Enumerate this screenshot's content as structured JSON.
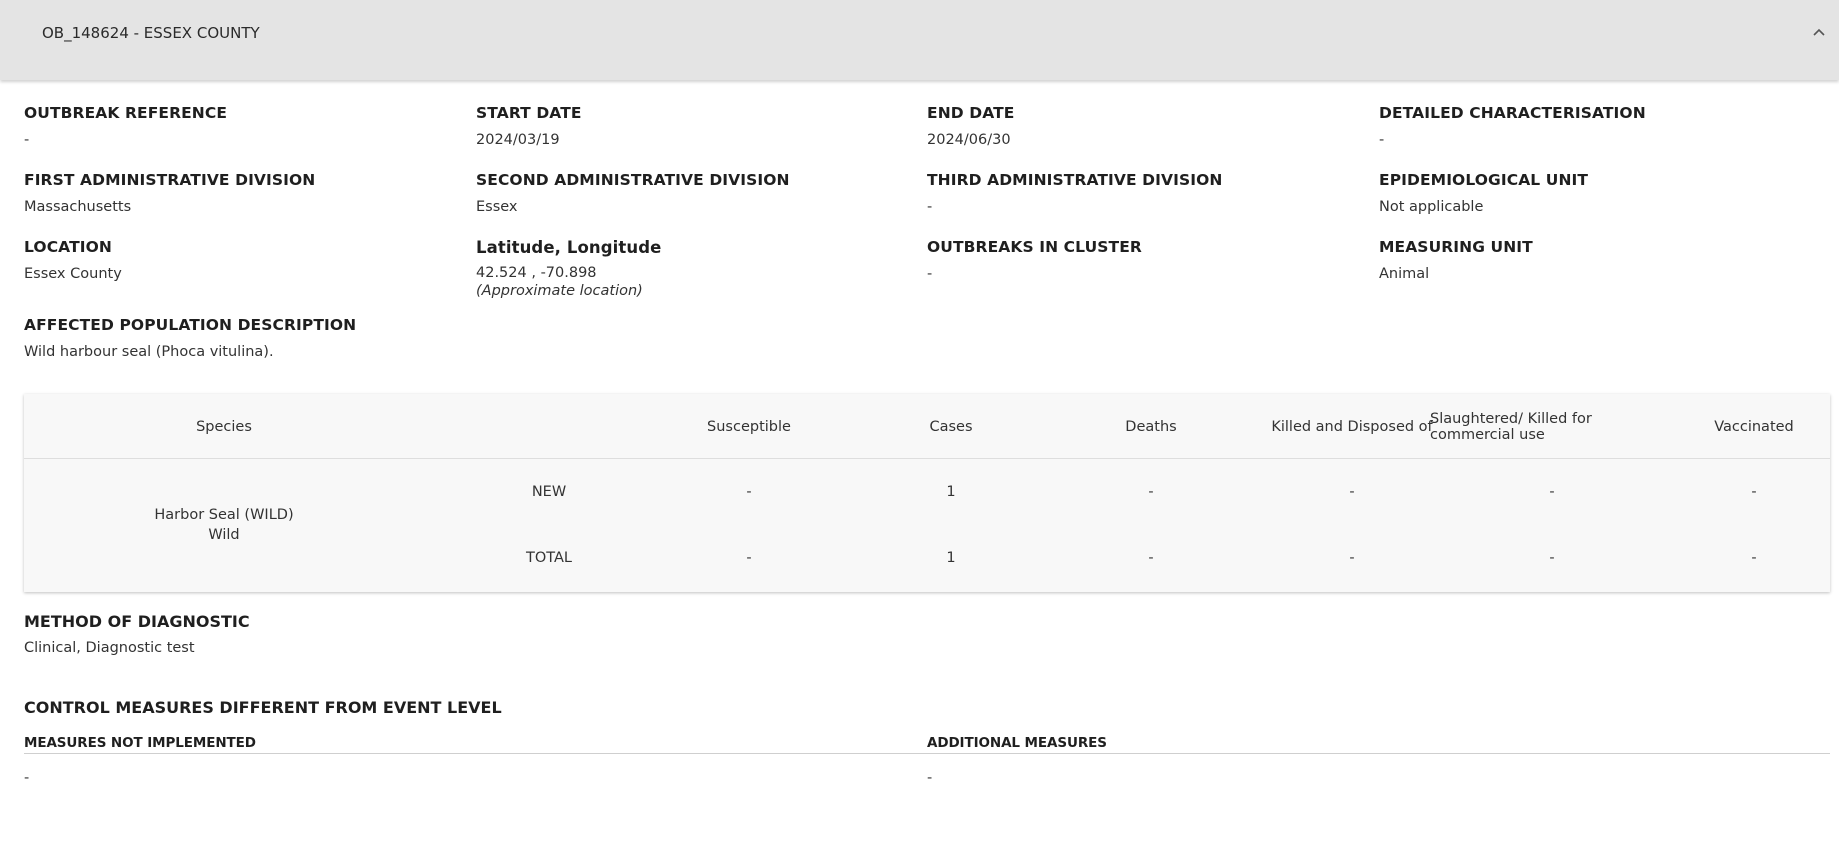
{
  "header": {
    "title": "OB_148624 - ESSEX COUNTY",
    "collapse_icon": "chevron-up-icon"
  },
  "fields": {
    "outbreak_reference": {
      "label": "OUTBREAK REFERENCE",
      "value": "-"
    },
    "start_date": {
      "label": "START DATE",
      "value": "2024/03/19"
    },
    "end_date": {
      "label": "END DATE",
      "value": "2024/06/30"
    },
    "detailed_characterisation": {
      "label": "DETAILED CHARACTERISATION",
      "value": "-"
    },
    "first_admin_division": {
      "label": "FIRST ADMINISTRATIVE DIVISION",
      "value": "Massachusetts"
    },
    "second_admin_division": {
      "label": "SECOND ADMINISTRATIVE DIVISION",
      "value": "Essex"
    },
    "third_admin_division": {
      "label": "THIRD ADMINISTRATIVE DIVISION",
      "value": "-"
    },
    "epidemiological_unit": {
      "label": "EPIDEMIOLOGICAL UNIT",
      "value": "Not applicable"
    },
    "location": {
      "label": "LOCATION",
      "value": "Essex County"
    },
    "lat_lon": {
      "label": "Latitude, Longitude",
      "value": "42.524 , -70.898",
      "note": "(Approximate location)"
    },
    "outbreaks_in_cluster": {
      "label": "OUTBREAKS IN CLUSTER",
      "value": "-"
    },
    "measuring_unit": {
      "label": "MEASURING UNIT",
      "value": "Animal"
    },
    "affected_population": {
      "label": "AFFECTED POPULATION DESCRIPTION",
      "value": "Wild harbour seal (Phoca vitulina)."
    }
  },
  "table": {
    "headers": {
      "species": "Species",
      "susceptible": "Susceptible",
      "cases": "Cases",
      "deaths": "Deaths",
      "killed_disposed": "Killed and Disposed of",
      "slaughtered": "Slaughtered/ Killed for commercial use",
      "vaccinated": "Vaccinated"
    },
    "species_name": "Harbor Seal (WILD)",
    "species_type": "Wild",
    "rows": [
      {
        "label": "NEW",
        "susceptible": "-",
        "cases": "1",
        "deaths": "-",
        "killed_disposed": "-",
        "slaughtered": "-",
        "vaccinated": "-"
      },
      {
        "label": "TOTAL",
        "susceptible": "-",
        "cases": "1",
        "deaths": "-",
        "killed_disposed": "-",
        "slaughtered": "-",
        "vaccinated": "-"
      }
    ]
  },
  "diagnostic": {
    "label": "METHOD OF DIAGNOSTIC",
    "value": "Clinical, Diagnostic test"
  },
  "control_measures": {
    "label": "CONTROL MEASURES DIFFERENT FROM EVENT LEVEL",
    "not_implemented_label": "MEASURES NOT IMPLEMENTED",
    "not_implemented_value": "-",
    "additional_label": "ADDITIONAL MEASURES",
    "additional_value": "-"
  }
}
